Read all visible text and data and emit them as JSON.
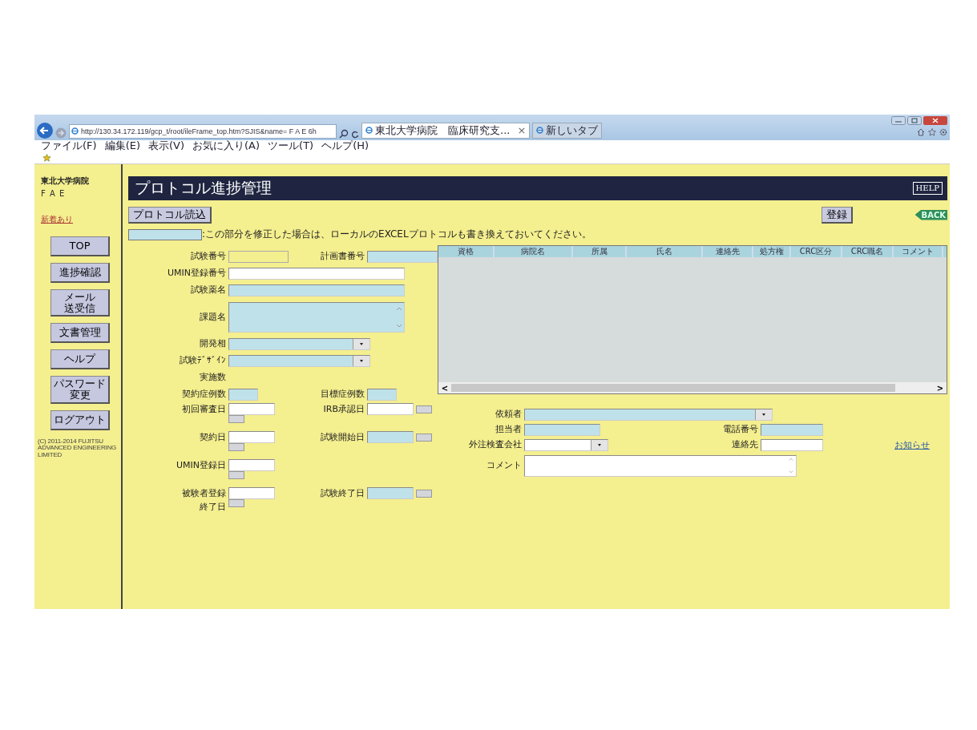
{
  "browser": {
    "address": "http://130.34.172.119/gcp_t/root/ileFrame_top.htm?SJIS&name= F A E 6h",
    "tabs": [
      {
        "label": "東北大学病院　臨床研究支...",
        "close": "×",
        "selected": true
      },
      {
        "label": "新しいタブ",
        "selected": false
      }
    ],
    "menu": [
      "ファイル(F)",
      "編集(E)",
      "表示(V)",
      "お気に入り(A)",
      "ツール(T)",
      "ヘルプ(H)"
    ]
  },
  "sidebar": {
    "org": "東北大学病院",
    "user": "F A E",
    "notice": "新着あり",
    "buttons": [
      {
        "lines": [
          "TOP"
        ]
      },
      {
        "lines": [
          "進捗確認"
        ]
      },
      {
        "lines": [
          "メール",
          "送受信"
        ]
      },
      {
        "lines": [
          "文書管理"
        ]
      },
      {
        "lines": [
          "ヘルプ"
        ]
      },
      {
        "lines": [
          "パスワード",
          "変更"
        ]
      },
      {
        "lines": [
          "ログアウト"
        ]
      }
    ],
    "copyright": [
      "(C) 2011-2014 FUJITSU",
      "ADVANCED ENGINEERING",
      "LIMITED"
    ]
  },
  "title": "プロトコル進捗管理",
  "help": "HELP",
  "load_button": "プロトコル読込",
  "save_button": "登録",
  "back": "BACK",
  "note": ":この部分を修正した場合は、ローカルのEXCELプロトコルも書き換えておいてください。",
  "form": [
    {
      "fields": [
        {
          "label": "試験番号",
          "kind": "text"
        },
        {
          "label": "計画書番号",
          "kind": "text"
        }
      ]
    },
    {
      "fields": [
        {
          "label": "UMIN登録番号",
          "kind": "text"
        }
      ]
    },
    {
      "fields": [
        {
          "label": "試験薬名",
          "kind": "text"
        }
      ]
    },
    {
      "fields": [
        {
          "label": "課題名",
          "kind": "textarea"
        }
      ]
    },
    {
      "fields": [
        {
          "label": "開発相",
          "kind": "select"
        }
      ]
    },
    {
      "fields": [
        {
          "label": "試験ﾃﾞｻﾞｲﾝ",
          "kind": "select"
        }
      ]
    },
    {
      "fields": [
        {
          "label": "実施数",
          "kind": "label"
        }
      ]
    },
    {
      "fields": [
        {
          "label": "契約症例数",
          "kind": "text"
        },
        {
          "label": "目標症例数",
          "kind": "text"
        }
      ]
    },
    {
      "fields": [
        {
          "label": "初回審査日",
          "kind": "date"
        },
        {
          "label": "IRB承認日",
          "kind": "date"
        }
      ]
    },
    {
      "fields": [
        {
          "label": "契約日",
          "kind": "date"
        },
        {
          "label": "試験開始日",
          "kind": "date"
        }
      ]
    },
    {
      "fields": [
        {
          "label": "UMIN登録日",
          "kind": "date"
        }
      ]
    },
    {
      "fields": [
        {
          "label_lines": [
            "被験者登録",
            "終了日"
          ],
          "kind": "date"
        },
        {
          "label": "試験終了日",
          "kind": "date"
        }
      ]
    }
  ],
  "table": {
    "columns": [
      "資格",
      "病院名",
      "所属",
      "氏名",
      "連絡先",
      "処方権",
      "CRC区分",
      "CRC職名",
      "コメント"
    ],
    "scroll_left": "<",
    "scroll_right": ">"
  },
  "client_form": [
    {
      "fields": [
        {
          "label": "依頼者",
          "kind": "select"
        }
      ]
    },
    {
      "fields": [
        {
          "label": "担当者",
          "kind": "text"
        },
        {
          "label": "電話番号",
          "kind": "text"
        }
      ]
    },
    {
      "fields": [
        {
          "label": "外注検査会社",
          "kind": "select"
        },
        {
          "label": "連絡先",
          "kind": "text"
        }
      ],
      "link": "お知らせ"
    },
    {
      "fields": [
        {
          "label": "コメント",
          "kind": "textarea"
        }
      ]
    }
  ]
}
